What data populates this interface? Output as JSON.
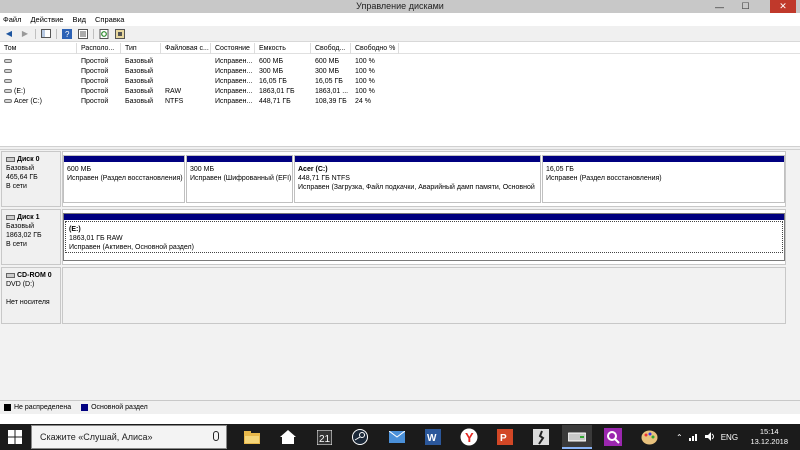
{
  "window": {
    "title": "Управление дисками",
    "minimize": "—",
    "maximize": "☐",
    "close": "✕"
  },
  "menu": [
    "Файл",
    "Действие",
    "Вид",
    "Справка"
  ],
  "toolbar": [
    "back-icon",
    "forward-icon",
    "console-tree-icon",
    "help-icon",
    "properties-icon",
    "refresh-icon",
    "settings-icon"
  ],
  "volumes": {
    "columns": [
      "Том",
      "Располо...",
      "Тип",
      "Файловая с...",
      "Состояние",
      "Емкость",
      "Свобод...",
      "Свободно %"
    ],
    "rows": [
      [
        "",
        "Простой",
        "Базовый",
        "",
        "Исправен...",
        "600 МБ",
        "600 МБ",
        "100 %"
      ],
      [
        "",
        "Простой",
        "Базовый",
        "",
        "Исправен...",
        "300 МБ",
        "300 МБ",
        "100 %"
      ],
      [
        "",
        "Простой",
        "Базовый",
        "",
        "Исправен...",
        "16,05 ГБ",
        "16,05 ГБ",
        "100 %"
      ],
      [
        "(E:)",
        "Простой",
        "Базовый",
        "RAW",
        "Исправен...",
        "1863,01 ГБ",
        "1863,01 ...",
        "100 %"
      ],
      [
        "Acer (C:)",
        "Простой",
        "Базовый",
        "NTFS",
        "Исправен...",
        "448,71 ГБ",
        "108,39 ГБ",
        "24 %"
      ]
    ]
  },
  "disks": [
    {
      "name": "Диск 0",
      "type": "Базовый",
      "size": "465,64 ГБ",
      "status": "В сети",
      "partitions": [
        {
          "name": "",
          "size": "600 МБ",
          "status": "Исправен (Раздел восстановления)"
        },
        {
          "name": "",
          "size": "300 МБ",
          "status": "Исправен (Шифрованный (EFI)"
        },
        {
          "name": "Acer  (C:)",
          "size": "448,71 ГБ NTFS",
          "status": "Исправен (Загрузка, Файл подкачки, Аварийный дамп памяти, Основной"
        },
        {
          "name": "",
          "size": "16,05 ГБ",
          "status": "Исправен (Раздел восстановления)"
        }
      ]
    },
    {
      "name": "Диск 1",
      "type": "Базовый",
      "size": "1863,02 ГБ",
      "status": "В сети",
      "partitions": [
        {
          "name": "(E:)",
          "size": "1863,01 ГБ RAW",
          "status": "Исправен (Активен, Основной раздел)"
        }
      ]
    },
    {
      "name": "CD-ROM 0",
      "type": "DVD (D:)",
      "size": "",
      "status": "Нет носителя",
      "partitions": []
    }
  ],
  "legend": [
    {
      "label": "Не распределена",
      "color": "#000000"
    },
    {
      "label": "Основной раздел",
      "color": "#000080"
    }
  ],
  "taskbar": {
    "search_placeholder": "Скажите «Слушай, Алиса»",
    "apps": [
      "file-explorer-icon",
      "home-icon",
      "calendar-icon",
      "steam-icon",
      "mail-icon",
      "word-icon",
      "yandex-browser-icon",
      "powerpoint-icon",
      "game-icon",
      "disk-management-icon",
      "search-app-icon",
      "paint-icon"
    ],
    "tray": {
      "language": "ENG"
    },
    "clock": {
      "time": "15:14",
      "date": "13.12.2018"
    }
  }
}
